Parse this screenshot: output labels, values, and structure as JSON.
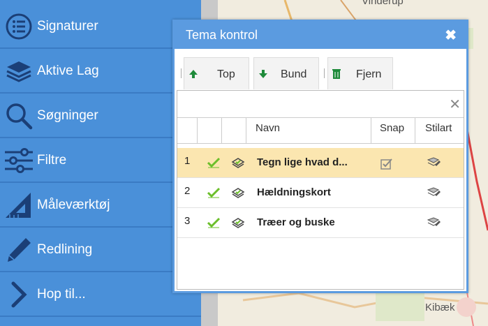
{
  "map": {
    "labels": [
      "Vinderup",
      "Kibæk"
    ]
  },
  "sidebar": {
    "items": [
      {
        "label": "Signaturer",
        "icon": "list-circle-icon"
      },
      {
        "label": "Aktive Lag",
        "icon": "layers-icon"
      },
      {
        "label": "Søgninger",
        "icon": "search-icon"
      },
      {
        "label": "Filtre",
        "icon": "sliders-icon"
      },
      {
        "label": "Måleværktøj",
        "icon": "ruler-triangle-icon"
      },
      {
        "label": "Redlining",
        "icon": "pencil-icon"
      },
      {
        "label": "Hop til...",
        "icon": "chevron-right-icon"
      }
    ]
  },
  "dialog": {
    "title": "Tema kontrol",
    "close": "✖",
    "toolbar": {
      "top_label": "Top",
      "bund_label": "Bund",
      "fjern_label": "Fjern"
    },
    "grid_close": "✕",
    "columns": [
      "Navn",
      "Snap",
      "Stilart"
    ],
    "rows": [
      {
        "num": "1",
        "name": "Tegn lige hvad d...",
        "snap": true,
        "selected": true
      },
      {
        "num": "2",
        "name": "Hældningskort",
        "snap": false,
        "selected": false
      },
      {
        "num": "3",
        "name": "Træer og buske",
        "snap": false,
        "selected": false
      }
    ]
  },
  "colors": {
    "sidebar": "#4a90d9",
    "dialog_header": "#5b9be0",
    "selected_row": "#fbe6b0",
    "check_green": "#6cbf2a",
    "arrow_green": "#1e8a3a"
  }
}
